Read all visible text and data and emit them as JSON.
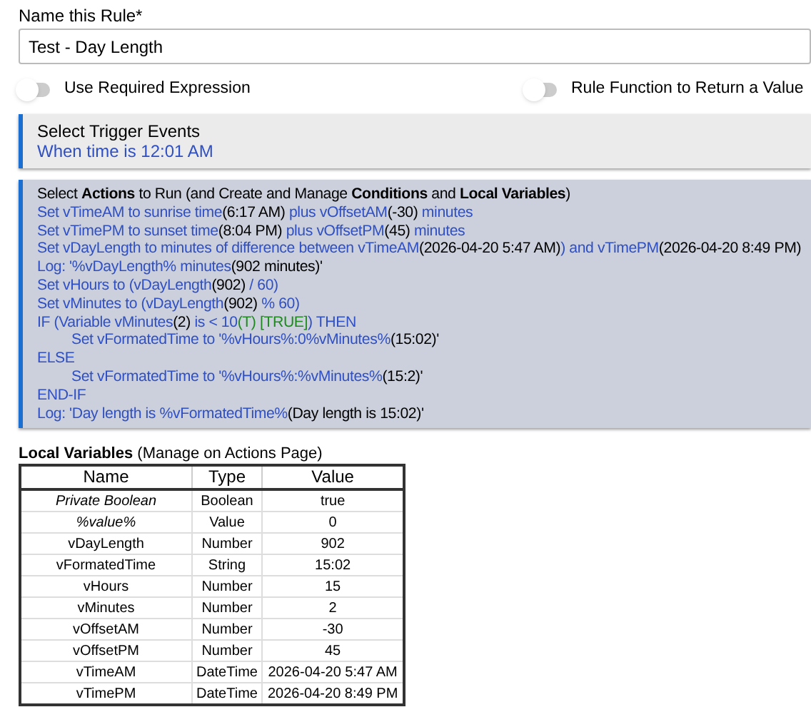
{
  "name_field": {
    "label": "Name this Rule*",
    "value": "Test - Day Length"
  },
  "toggles": [
    {
      "label": "Use Required Expression",
      "on": false
    },
    {
      "label": "Rule Function to Return a Value",
      "on": false
    }
  ],
  "trigger_panel": {
    "title": "Select Trigger Events",
    "lines": [
      "When time is 12:01 AM"
    ]
  },
  "actions_panel": {
    "title": "Select **Actions** to Run (and Create and Manage **Conditions** and **Local Variables**)",
    "lines": [
      {
        "indented": false,
        "parts": [
          {
            "kind": "link",
            "text": "Set vTimeAM to sunrise time"
          },
          {
            "kind": "value",
            "text": "(6:17 AM)"
          },
          {
            "kind": "link",
            "text": " plus vOffsetAM"
          },
          {
            "kind": "value",
            "text": "(-30)"
          },
          {
            "kind": "link",
            "text": " minutes"
          }
        ]
      },
      {
        "indented": false,
        "parts": [
          {
            "kind": "link",
            "text": "Set vTimePM to sunset time"
          },
          {
            "kind": "value",
            "text": "(8:04 PM)"
          },
          {
            "kind": "link",
            "text": " plus vOffsetPM"
          },
          {
            "kind": "value",
            "text": "(45)"
          },
          {
            "kind": "link",
            "text": " minutes"
          }
        ]
      },
      {
        "indented": false,
        "parts": [
          {
            "kind": "link",
            "text": "Set vDayLength to minutes of difference between vTimeAM"
          },
          {
            "kind": "value",
            "text": "(2026-04-20 5:47 AM)"
          },
          {
            "kind": "link",
            "text": ") and vTimePM"
          },
          {
            "kind": "value",
            "text": "(2026-04-20 8:49 PM)"
          }
        ]
      },
      {
        "indented": false,
        "parts": [
          {
            "kind": "link",
            "text": "Log: '%vDayLength% minutes"
          },
          {
            "kind": "value",
            "text": "(902 minutes)'"
          }
        ]
      },
      {
        "indented": false,
        "parts": [
          {
            "kind": "link",
            "text": "Set vHours to (vDayLength"
          },
          {
            "kind": "value",
            "text": "(902)"
          },
          {
            "kind": "link",
            "text": " / 60)"
          }
        ]
      },
      {
        "indented": false,
        "parts": [
          {
            "kind": "link",
            "text": "Set vMinutes to (vDayLength"
          },
          {
            "kind": "value",
            "text": "(902)"
          },
          {
            "kind": "link",
            "text": " % 60)"
          }
        ]
      },
      {
        "indented": false,
        "parts": [
          {
            "kind": "link",
            "text": "IF (Variable vMinutes"
          },
          {
            "kind": "value",
            "text": "(2)"
          },
          {
            "kind": "link",
            "text": " is < 10"
          },
          {
            "kind": "true",
            "text": "(T) [TRUE]"
          },
          {
            "kind": "link",
            "text": ") THEN"
          }
        ]
      },
      {
        "indented": true,
        "parts": [
          {
            "kind": "link",
            "text": "Set vFormatedTime to '%vHours%:0%vMinutes%"
          },
          {
            "kind": "value",
            "text": "(15:02)'"
          }
        ]
      },
      {
        "indented": false,
        "parts": [
          {
            "kind": "link",
            "text": "ELSE"
          }
        ]
      },
      {
        "indented": true,
        "parts": [
          {
            "kind": "link",
            "text": "Set vFormatedTime to '%vHours%:%vMinutes%"
          },
          {
            "kind": "value",
            "text": "(15:2)'"
          }
        ]
      },
      {
        "indented": false,
        "parts": [
          {
            "kind": "link",
            "text": "END-IF"
          }
        ]
      },
      {
        "indented": false,
        "parts": [
          {
            "kind": "link",
            "text": "Log: 'Day length is %vFormatedTime%"
          },
          {
            "kind": "value",
            "text": "(Day length is 15:02)'"
          }
        ]
      }
    ]
  },
  "local_variables": {
    "title": "**Local Variables** (Manage on Actions Page)",
    "columns": [
      "Name",
      "Type",
      "Value"
    ],
    "rows": [
      {
        "italic": true,
        "cells": [
          "Private Boolean",
          "Boolean",
          "true"
        ]
      },
      {
        "italic": true,
        "cells": [
          "%value%",
          "Value",
          "0"
        ]
      },
      {
        "italic": false,
        "cells": [
          "vDayLength",
          "Number",
          "902"
        ]
      },
      {
        "italic": false,
        "cells": [
          "vFormatedTime",
          "String",
          "15:02"
        ]
      },
      {
        "italic": false,
        "cells": [
          "vHours",
          "Number",
          "15"
        ]
      },
      {
        "italic": false,
        "cells": [
          "vMinutes",
          "Number",
          "2"
        ]
      },
      {
        "italic": false,
        "cells": [
          "vOffsetAM",
          "Number",
          "-30"
        ]
      },
      {
        "italic": false,
        "cells": [
          "vOffsetPM",
          "Number",
          "45"
        ]
      },
      {
        "italic": false,
        "cells": [
          "vTimeAM",
          "DateTime",
          "2026-04-20 5:47 AM"
        ]
      },
      {
        "italic": false,
        "cells": [
          "vTimePM",
          "DateTime",
          "2026-04-20 8:49 PM"
        ]
      }
    ]
  }
}
